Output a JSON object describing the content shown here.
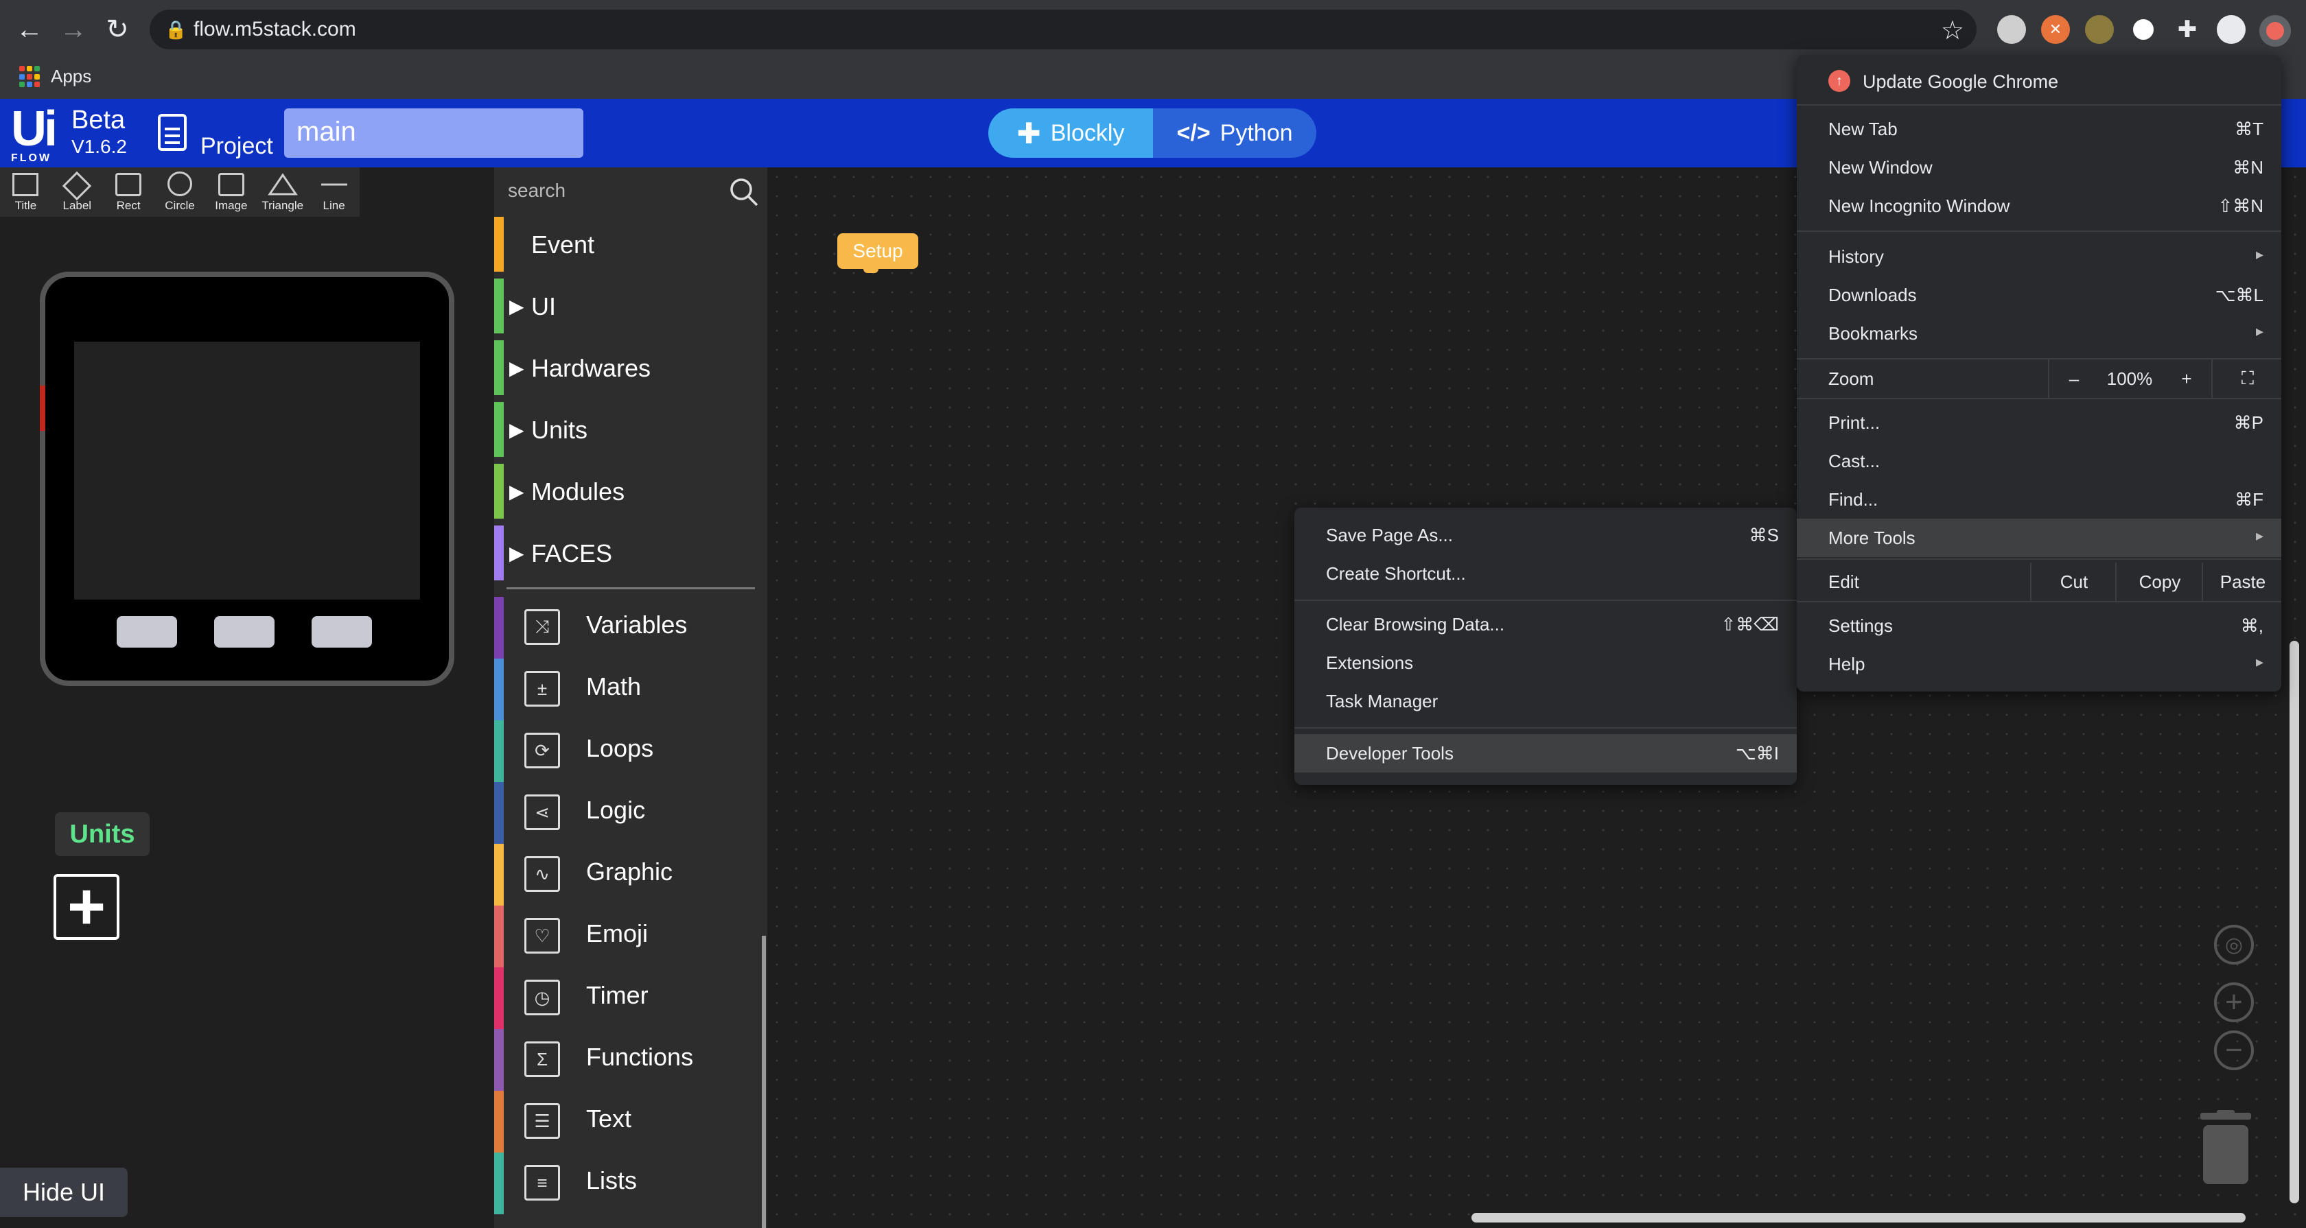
{
  "browser": {
    "url": "flow.m5stack.com",
    "bookmarks": {
      "apps_label": "Apps"
    }
  },
  "header": {
    "logo_beta": "Beta",
    "logo_version": "V1.6.2",
    "logo_flow": "FLOW",
    "project_label": "Project",
    "project_name": "main",
    "mode_blockly": "Blockly",
    "mode_python": "Python"
  },
  "ui_panel": {
    "tools": [
      "Title",
      "Label",
      "Rect",
      "Circle",
      "Image",
      "Triangle",
      "Line"
    ],
    "units_label": "Units",
    "hide_ui": "Hide UI"
  },
  "palette": {
    "search_placeholder": "search",
    "top_categories": [
      {
        "label": "Event",
        "color": "#f5a623"
      },
      {
        "label": "UI",
        "color": "#5ec45a"
      },
      {
        "label": "Hardwares",
        "color": "#5ec45a"
      },
      {
        "label": "Units",
        "color": "#5ec45a"
      },
      {
        "label": "Modules",
        "color": "#7bc64a"
      },
      {
        "label": "FACES",
        "color": "#a07cf0"
      }
    ],
    "categories": [
      {
        "label": "Variables",
        "color": "#7b3fb0",
        "icon": "shuffle-icon"
      },
      {
        "label": "Math",
        "color": "#4a90d9",
        "icon": "calculator-icon"
      },
      {
        "label": "Loops",
        "color": "#3fb59c",
        "icon": "loop-icon"
      },
      {
        "label": "Logic",
        "color": "#3a5ea8",
        "icon": "branch-icon"
      },
      {
        "label": "Graphic",
        "color": "#f5b942",
        "icon": "graph-icon"
      },
      {
        "label": "Emoji",
        "color": "#e06666",
        "icon": "heart-icon"
      },
      {
        "label": "Timer",
        "color": "#e0306a",
        "icon": "clock-icon"
      },
      {
        "label": "Functions",
        "color": "#8e5ab0",
        "icon": "sigma-icon"
      },
      {
        "label": "Text",
        "color": "#e07b3a",
        "icon": "text-icon"
      },
      {
        "label": "Lists",
        "color": "#3fb5a0",
        "icon": "list-icon"
      }
    ]
  },
  "workspace": {
    "setup_block": "Setup"
  },
  "chrome_menu": {
    "update": "Update Google Chrome",
    "new_tab": {
      "label": "New Tab",
      "shortcut": "⌘T"
    },
    "new_window": {
      "label": "New Window",
      "shortcut": "⌘N"
    },
    "new_incognito": {
      "label": "New Incognito Window",
      "shortcut": "⇧⌘N"
    },
    "history": "History",
    "downloads": {
      "label": "Downloads",
      "shortcut": "⌥⌘L"
    },
    "bookmarks": "Bookmarks",
    "zoom": {
      "label": "Zoom",
      "minus": "–",
      "value": "100%",
      "plus": "+"
    },
    "print": {
      "label": "Print...",
      "shortcut": "⌘P"
    },
    "cast": "Cast...",
    "find": {
      "label": "Find...",
      "shortcut": "⌘F"
    },
    "more_tools": "More Tools",
    "edit": {
      "label": "Edit",
      "cut": "Cut",
      "copy": "Copy",
      "paste": "Paste"
    },
    "settings": {
      "label": "Settings",
      "shortcut": "⌘,"
    },
    "help": "Help"
  },
  "more_tools_menu": {
    "save_page": {
      "label": "Save Page As...",
      "shortcut": "⌘S"
    },
    "create_shortcut": "Create Shortcut...",
    "clear_data": {
      "label": "Clear Browsing Data...",
      "shortcut": "⇧⌘⌫"
    },
    "extensions": "Extensions",
    "task_manager": "Task Manager",
    "developer_tools": {
      "label": "Developer Tools",
      "shortcut": "⌥⌘I"
    }
  }
}
